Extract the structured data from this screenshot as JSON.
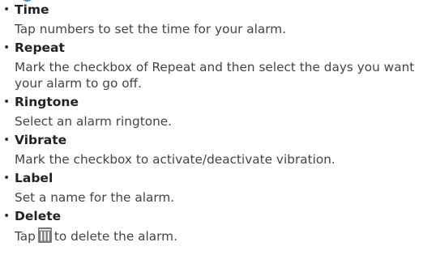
{
  "items": [
    {
      "heading": "Time",
      "desc": "Tap numbers to set the time for your alarm."
    },
    {
      "heading": "Repeat",
      "desc": "Mark the checkbox of Repeat and then select the days you want your alarm to go off."
    },
    {
      "heading": "Ringtone",
      "desc": "Select an alarm ringtone."
    },
    {
      "heading": "Vibrate",
      "desc": "Mark the checkbox to activate/deactivate vibration."
    },
    {
      "heading": "Label",
      "desc": "Set a name for the alarm."
    },
    {
      "heading": "Delete",
      "desc_before": "Tap",
      "desc_after": "to delete the alarm.",
      "icon": "trash-icon"
    }
  ],
  "bullet_char": "•"
}
